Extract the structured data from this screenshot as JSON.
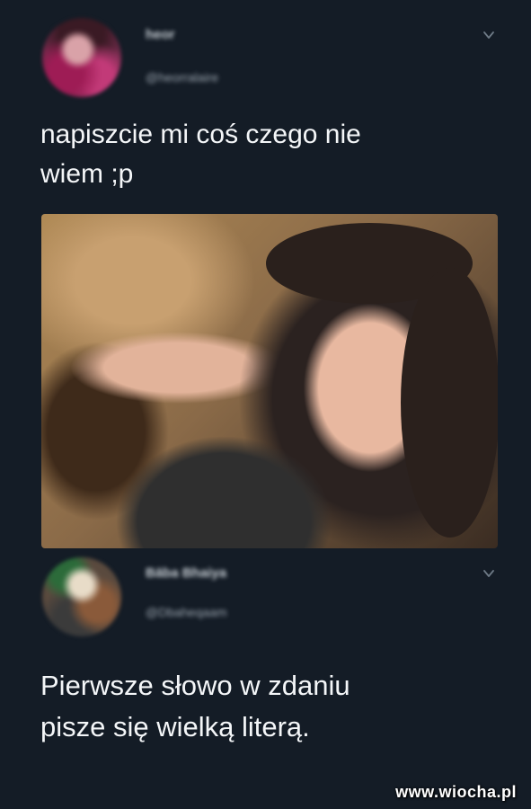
{
  "tweets": [
    {
      "display_name": "heor",
      "handle": "@heorralaire",
      "text_lines": [
        "napiszcie mi coś czego nie",
        "wiem ;p"
      ],
      "has_photo": true
    },
    {
      "display_name": "Bāba Bhaiya",
      "handle": "@Dbaheqaam",
      "text_lines": [
        "Pierwsze słowo w zdaniu",
        "pisze się wielką literą."
      ],
      "has_photo": false
    }
  ],
  "watermark": "www.wiocha.pl",
  "icons": {
    "more": "chevron-down-icon"
  },
  "colors": {
    "background": "#141c26",
    "text": "#f4f6f8",
    "muted": "#9aa4ae"
  }
}
